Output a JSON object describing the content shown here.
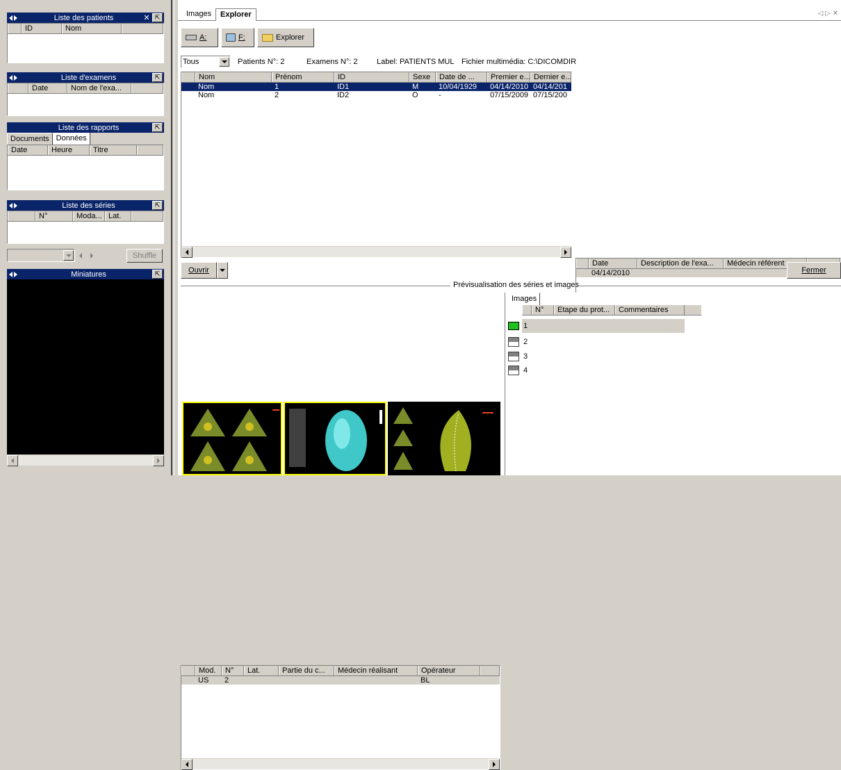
{
  "left_panels": {
    "patients": {
      "title": "Liste des patients",
      "columns": [
        "ID",
        "Nom"
      ]
    },
    "exams": {
      "title": "Liste d'examens",
      "columns": [
        "Date",
        "Nom de l'exa..."
      ]
    },
    "reports": {
      "title": "Liste des rapports",
      "tabs": [
        "Documents",
        "Données"
      ],
      "columns": [
        "Date",
        "Heure",
        "Titre"
      ]
    },
    "series": {
      "title": "Liste des séries",
      "columns": [
        "N°",
        "Moda...",
        "Lat."
      ]
    },
    "shuffle_label": "Shuffle",
    "thumbnails": {
      "title": "Miniatures"
    }
  },
  "main": {
    "tabs": [
      "Images",
      "Explorer"
    ],
    "toolbar": {
      "drive_a": "A:",
      "drive_f": "F:",
      "explorer": "Explorer"
    },
    "filter": {
      "selected": "Tous"
    },
    "info": {
      "patients": "Patients N°: 2",
      "exams": "Examens N°: 2",
      "label": "Label: PATIENTS MUL",
      "media": "Fichier multimédia: C:\\DICOMDIR"
    },
    "patient_table": {
      "columns": [
        "Nom",
        "Prénom",
        "ID",
        "Sexe",
        "Date de ...",
        "Premier e...",
        "Dernier e..."
      ],
      "rows": [
        [
          "Nom",
          "1",
          "ID1",
          "M",
          "10/04/1929",
          "04/14/2010",
          "04/14/201"
        ],
        [
          "Nom",
          "2",
          "ID2",
          "O",
          "-",
          "07/15/2009",
          "07/15/200"
        ]
      ]
    },
    "exam_table": {
      "columns": [
        "Date",
        "Description de l'exa...",
        "Médecin référent"
      ],
      "rows": [
        [
          "04/14/2010",
          "",
          ""
        ]
      ]
    },
    "open_button": "Ouvrir",
    "close_button": "Fermer",
    "preview_title": "Prévisualisation des séries et images",
    "series_table": {
      "columns": [
        "Mod.",
        "N°",
        "Lat.",
        "Partie du c...",
        "Médecin réalisant",
        "Opérateur"
      ],
      "rows": [
        [
          "US",
          "2",
          "",
          "",
          "",
          "BL"
        ]
      ]
    },
    "images_panel": {
      "tab": "Images",
      "columns": [
        "N°",
        "Etape du prot...",
        "Commentaires"
      ],
      "rows": [
        "1",
        "2",
        "3",
        "4"
      ]
    }
  },
  "colors": {
    "title_bar": "#0a246a",
    "selection": "#0a246a",
    "window_bg": "#d4d0c8",
    "thumb_highlight": "#ffff00"
  }
}
